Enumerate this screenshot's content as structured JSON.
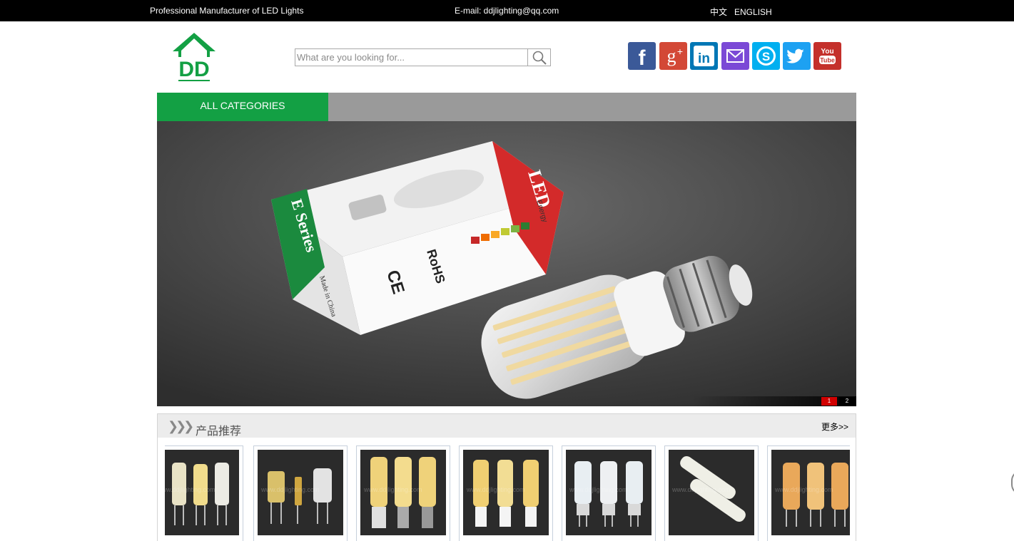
{
  "topbar": {
    "tagline": "Professional Manufacturer of LED Lights",
    "email": "E-mail: ddjlighting@qq.com",
    "lang_cn": "中文",
    "lang_en": "ENGLISH"
  },
  "logo": {
    "text": "DD"
  },
  "search": {
    "placeholder": "What are you looking for..."
  },
  "social": [
    {
      "name": "facebook-icon",
      "color": "#3b5998"
    },
    {
      "name": "google-plus-icon",
      "color": "#d34836"
    },
    {
      "name": "linkedin-icon",
      "color": "#0077b5"
    },
    {
      "name": "email-icon",
      "color": "#7b49d6"
    },
    {
      "name": "skype-icon",
      "color": "#00aff0"
    },
    {
      "name": "twitter-icon",
      "color": "#1da1f2"
    },
    {
      "name": "youtube-icon",
      "color": "#c4302b",
      "label_top": "You",
      "label_bottom": "Tube"
    }
  ],
  "nav": {
    "all_categories": "ALL CATEGORIES"
  },
  "banner": {
    "box_label_top": "LED",
    "box_label_side": "E Series",
    "box_rohs": "RoHS",
    "box_ce": "CE",
    "box_made": "Made in China",
    "box_energy": "Energy",
    "pages": [
      "1",
      "2"
    ],
    "active_page": "1"
  },
  "recommend": {
    "title": "产品推荐",
    "more": "更多>>",
    "watermark": "www.ddjlighting.com"
  },
  "colors": {
    "brand_green": "#13a044",
    "nav_gray": "#9a9a9a"
  }
}
